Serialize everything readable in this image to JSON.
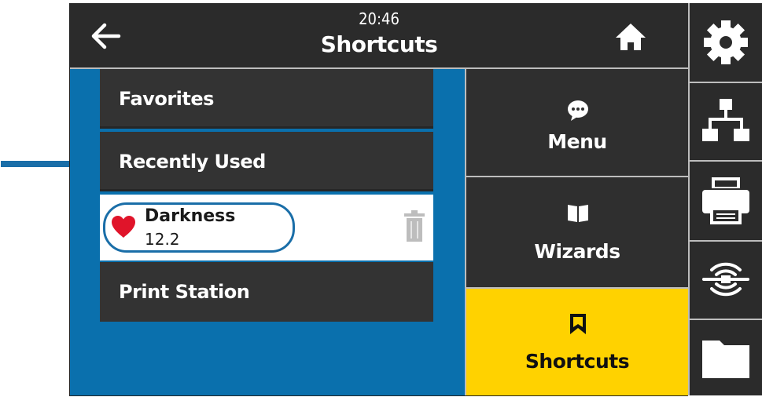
{
  "header": {
    "time": "20:46",
    "title": "Shortcuts"
  },
  "list": {
    "items": [
      {
        "label": "Favorites"
      },
      {
        "label": "Recently Used"
      },
      {
        "label": "Print Station"
      }
    ],
    "favorite": {
      "name": "Darkness",
      "value": "12.2"
    }
  },
  "nav": [
    {
      "label": "Menu",
      "icon": "menu-bubble-icon"
    },
    {
      "label": "Wizards",
      "icon": "book-icon"
    },
    {
      "label": "Shortcuts",
      "icon": "bookmark-icon",
      "active": true
    }
  ],
  "side": [
    "gear-icon",
    "network-icon",
    "printer-icon",
    "wireless-icon",
    "folder-icon"
  ],
  "colors": {
    "accent": "#ffd200",
    "background": "#0a70ad",
    "panel": "#333333",
    "heart": "#e0142a",
    "callout_arrow": "#1a6ea8"
  }
}
